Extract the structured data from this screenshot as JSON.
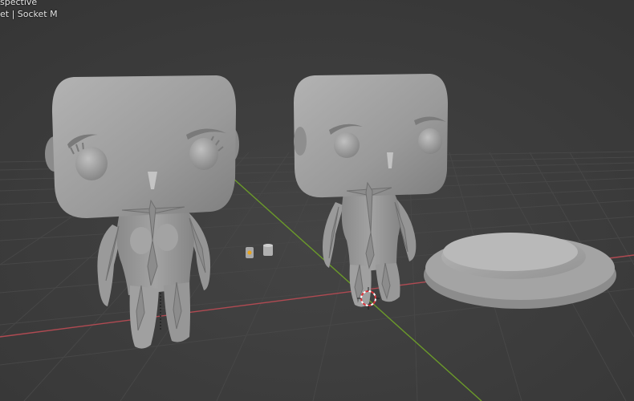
{
  "viewport": {
    "view_mode": "spective",
    "collection_info": "et | Socket M"
  },
  "colors": {
    "background": "#3b3b3b",
    "grid": "#474747",
    "x_axis": "#b04a52",
    "y_axis": "#6b9a2a",
    "mesh": "#9a9a9a",
    "bone": "#7d7d7d"
  },
  "icons": [
    "3d-cursor-icon",
    "light-icon",
    "camera-icon"
  ]
}
